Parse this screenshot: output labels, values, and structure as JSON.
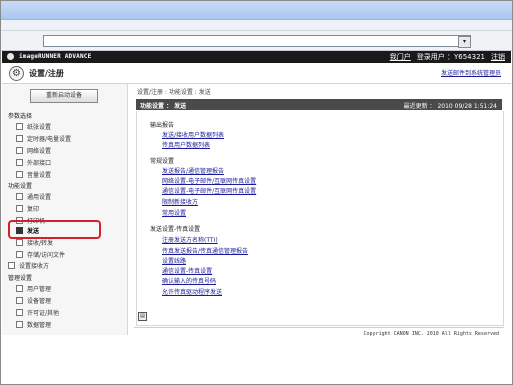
{
  "browser": {
    "address_button": "▾"
  },
  "brand": {
    "product": "imageRUNNER ADVANCE",
    "my_portal": "我门户",
    "login_user": "登录用户 ：",
    "user_id": "Y654321",
    "logout": "注销"
  },
  "header": {
    "title": "设置/注册",
    "email_link": "发送邮件到系统管理员"
  },
  "sidebar": {
    "home_button": "重新启动设备",
    "sections": [
      {
        "label": "参数选择",
        "items": [
          "纸张设置",
          "定时器/电量设置",
          "网络设置",
          "外部接口",
          "音量设置"
        ]
      },
      {
        "label": "功能设置",
        "items": [
          "通用设置",
          "复印",
          "打印机",
          "发送",
          "接收/转发",
          "存储/访问文件"
        ]
      },
      {
        "label": "设置接收方",
        "items": []
      },
      {
        "label": "管理设置",
        "items": [
          "用户管理",
          "设备管理",
          "许可证/其他",
          "数据管理"
        ]
      }
    ]
  },
  "main": {
    "breadcrumb": "设置/注册 : 功能设置 : 发送",
    "panel_title": "功能设置 ： 发送",
    "update_label": "最近更新 ：",
    "update_time": "2010 09/28 1:51:24",
    "groups": [
      {
        "title": "输出报告",
        "links": [
          "发送/接收用户数据列表",
          "传真用户数据列表"
        ]
      },
      {
        "title": "常规设置",
        "links": [
          "发送报告/通信管理报告",
          "网络设置-电子邮件/互联网传真设置",
          "通信设置-电子邮件/互联网传真设置",
          "限制新接收方",
          "常用设置"
        ]
      },
      {
        "title": "发送设置-传真设置",
        "links": [
          "注册发送方名称(TTI)",
          "传真发送报告/传真通信管理报告",
          "设置线路",
          "通信设置-传真设置",
          "确认输入的传真号码",
          "允许传真驱动程序发送"
        ]
      }
    ],
    "print_icon": "▤",
    "copyright": "Copyright CANON INC. 2010 All Rights Reserved"
  }
}
